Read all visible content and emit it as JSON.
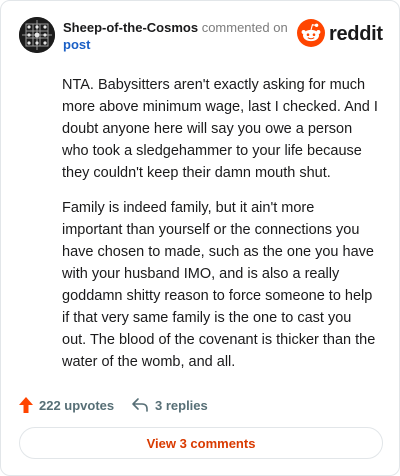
{
  "header": {
    "author": "Sheep-of-the-Cosmos",
    "action": "commented on",
    "post_link": "post",
    "brand": "reddit"
  },
  "comment": {
    "paragraphs": [
      "NTA. Babysitters aren't exactly asking for much more above minimum wage, last I checked. And I doubt anyone here will say you owe a person who took a sledgehammer to your life because they couldn't keep their damn mouth shut.",
      "Family is indeed family, but it ain't more important than yourself or the connections you have chosen to made, such as the one you have with your husband IMO, and is also a really goddamn shitty reason to force someone to help if that very same family is the one to cast you out. The blood of the covenant is thicker than the water of the womb, and all."
    ]
  },
  "footer": {
    "upvotes": "222 upvotes",
    "replies": "3 replies",
    "view_comments": "View 3 comments"
  },
  "icons": {
    "avatar": "avatar-icon",
    "brand": "reddit-logo-icon",
    "upvote": "upvote-arrow-icon",
    "reply": "reply-arrow-icon"
  },
  "colors": {
    "brand": "#ff4500",
    "upvote": "#ff4500",
    "link": "#1a5fc5",
    "view_comments": "#d93a00"
  }
}
